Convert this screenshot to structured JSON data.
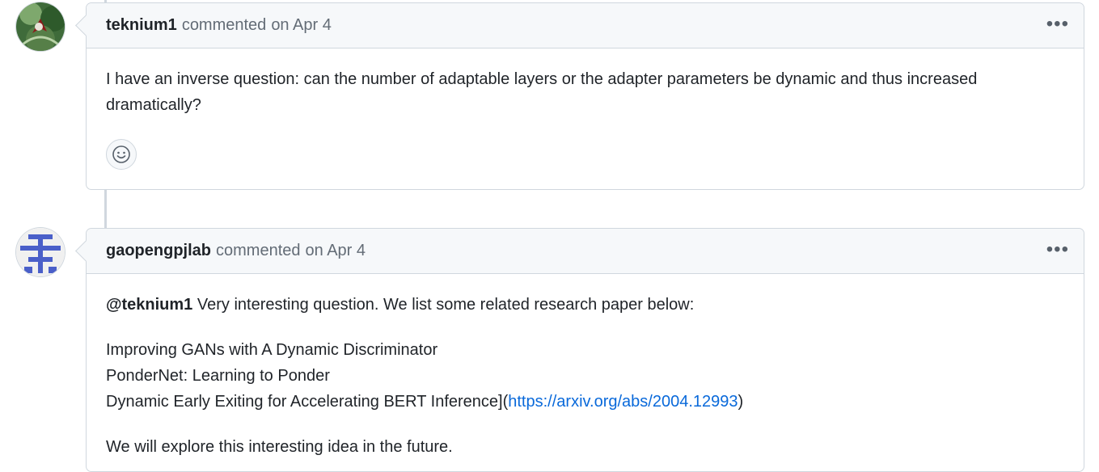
{
  "comments": [
    {
      "author": "teknium1",
      "action": "commented",
      "date": "on Apr 4",
      "body": "I have an inverse question: can the number of adaptable layers or the adapter parameters be dynamic and thus increased dramatically?"
    },
    {
      "author": "gaopengpjlab",
      "action": "commented",
      "date": "on Apr 4",
      "mention": "@teknium1",
      "intro": " Very interesting question. We list some related research paper below:",
      "papers": [
        "Improving GANs with A Dynamic Discriminator",
        "PonderNet: Learning to Ponder",
        "Dynamic Early Exiting for Accelerating BERT Inference]("
      ],
      "link_text": "https://arxiv.org/abs/2004.12993",
      "link_suffix": ")",
      "outro": "We will explore this interesting idea in the future."
    }
  ],
  "icons": {
    "menu": "kebab-horizontal-icon",
    "reaction": "smiley-icon"
  }
}
